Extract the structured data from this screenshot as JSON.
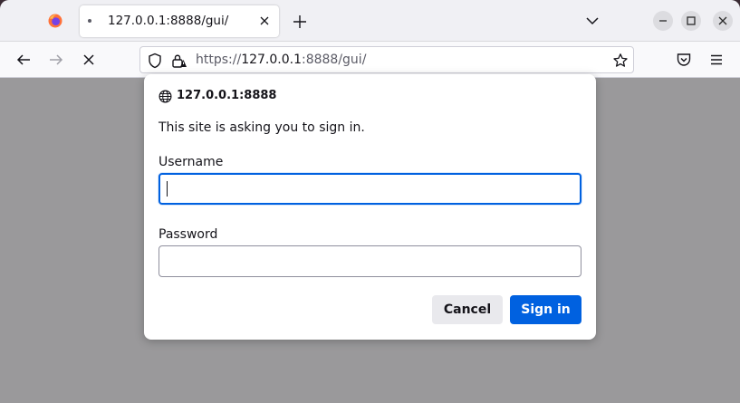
{
  "tab": {
    "title": "127.0.0.1:8888/gui/",
    "icon": "loading-dot-icon"
  },
  "urlbar": {
    "scheme": "https://",
    "host": "127.0.0.1",
    "rest": ":8888/gui/"
  },
  "dialog": {
    "host": "127.0.0.1:8888",
    "message": "This site is asking you to sign in.",
    "username_label": "Username",
    "username_value": "",
    "password_label": "Password",
    "password_value": "",
    "cancel_label": "Cancel",
    "signin_label": "Sign in"
  },
  "colors": {
    "accent": "#0061e0",
    "backdrop": "#9a999b",
    "toolbar": "#f9f9fb",
    "tabstrip": "#f0f0f4"
  }
}
